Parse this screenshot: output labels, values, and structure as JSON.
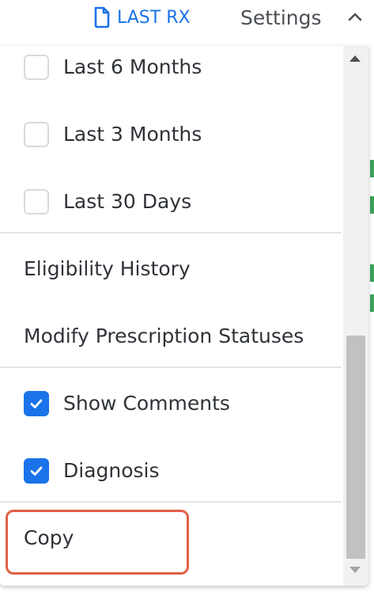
{
  "toolbar": {
    "last_rx_label": "LAST RX",
    "last_rx_icon": "document-icon",
    "settings_label": "Settings",
    "collapse_icon": "chevron-up-icon",
    "accent_color": "#1a73e8"
  },
  "menu": {
    "items": [
      {
        "label": "Last 6 Months",
        "type": "checkbox",
        "checked": false
      },
      {
        "label": "Last 3 Months",
        "type": "checkbox",
        "checked": false
      },
      {
        "label": "Last 30 Days",
        "type": "checkbox",
        "checked": false
      },
      {
        "label": "Eligibility History",
        "type": "action"
      },
      {
        "label": "Modify Prescription Statuses",
        "type": "action"
      },
      {
        "label": "Show Comments",
        "type": "checkbox",
        "checked": true
      },
      {
        "label": "Diagnosis",
        "type": "checkbox",
        "checked": true
      },
      {
        "label": "Copy",
        "type": "action",
        "highlighted": true
      }
    ],
    "highlight_color": "#e05f45"
  }
}
